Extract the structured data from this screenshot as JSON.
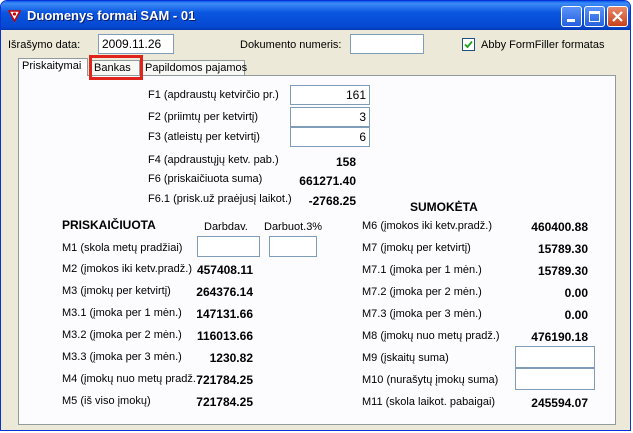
{
  "window": {
    "title": "Duomenys formai SAM - 01"
  },
  "header": {
    "israsymo_label": "Išrašymo data:",
    "israsymo_value": "2009.11.26",
    "dokumento_label": "Dokumento numeris:",
    "dokumento_value": "",
    "abby_label": "Abby FormFiller formatas",
    "abby_checked": true
  },
  "tabs": [
    {
      "label": "Priskaitymai"
    },
    {
      "label": "Bankas"
    },
    {
      "label": "Papildomos pajamos"
    }
  ],
  "f_fields": [
    {
      "label": "F1 (apdraustų ketvirčio pr.)",
      "value": "161"
    },
    {
      "label": "F2 (priimtų per ketvirtį)",
      "value": "3"
    },
    {
      "label": "F3 (atleistų per ketvirtį)",
      "value": "6"
    }
  ],
  "f_values": [
    {
      "label": "F4 (apdraustųjų ketv. pab.)",
      "value": "158"
    },
    {
      "label": "F6 (priskaičiuota suma)",
      "value": "661271.40"
    },
    {
      "label": "F6.1 (prisk.už praėjusį laikot.)",
      "value": "-2768.25"
    }
  ],
  "priskaiciuota": {
    "title": "PRISKAIČIUOTA",
    "col_darbdav": "Darbdav.",
    "col_darbuot": "Darbuot.3%",
    "m1_label": "M1 (skola metų pradžiai)",
    "m1_darbdav": "",
    "m1_darbuot": "",
    "rows": [
      {
        "label": "M2 (įmokos iki ketv.pradž.)",
        "value": "457408.11"
      },
      {
        "label": "M3 (įmokų per ketvirtį)",
        "value": "264376.14"
      },
      {
        "label": "M3.1 (įmoka per 1 mėn.)",
        "value": "147131.66"
      },
      {
        "label": "M3.2 (įmoka per 2 mėn.)",
        "value": "116013.66"
      },
      {
        "label": "M3.3 (įmoka per 3 mėn.)",
        "value": "1230.82"
      },
      {
        "label": "M4 (įmokų nuo metų pradž.",
        "value": "721784.25"
      },
      {
        "label": "M5 (iš viso įmokų)",
        "value": "721784.25"
      }
    ]
  },
  "sumoketa": {
    "title": "SUMOKĖTA",
    "rows": [
      {
        "label": "M6 (įmokos iki ketv.pradž.)",
        "value": "460400.88"
      },
      {
        "label": "M7 (įmokų per ketvirtį)",
        "value": "15789.30"
      },
      {
        "label": "M7.1 (įmoka per 1 mėn.)",
        "value": "15789.30"
      },
      {
        "label": "M7.2 (įmoka per 2 mėn.)",
        "value": "0.00"
      },
      {
        "label": "M7.3 (įmoka per 3 mėn.)",
        "value": "0.00"
      },
      {
        "label": "M8 (įmokų nuo metų pradž.)",
        "value": "476190.18"
      }
    ],
    "m9_label": "M9 (įskaitų suma)",
    "m9_value": "",
    "m10_label": "M10 (nurašytų įmokų suma)",
    "m10_value": "",
    "m11_label": "M11 (skola laikot. pabaigai)",
    "m11_value": "245594.07"
  }
}
